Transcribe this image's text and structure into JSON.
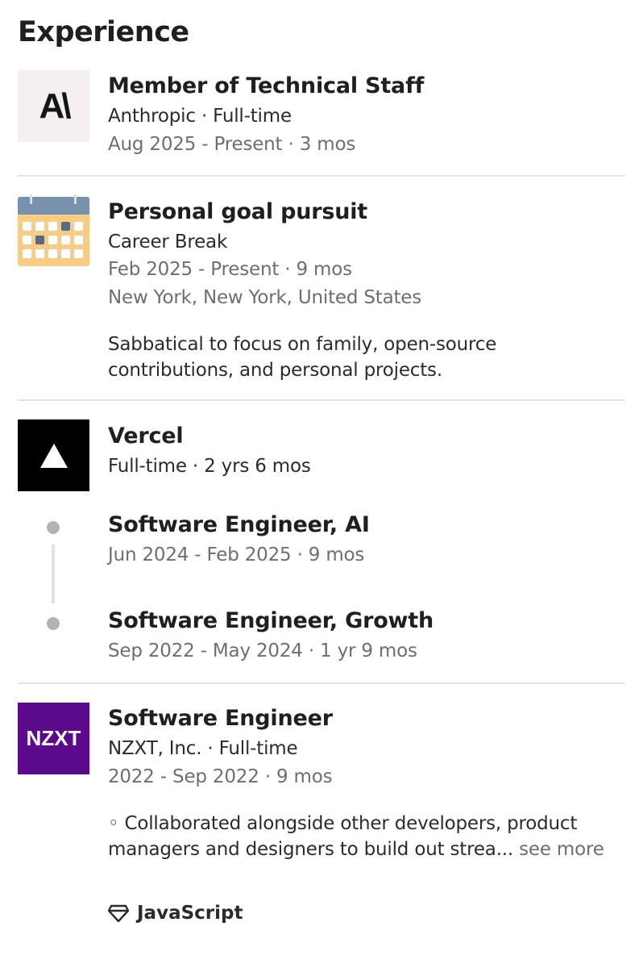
{
  "section": {
    "title": "Experience"
  },
  "entries": {
    "anthropic": {
      "logo_text": "A\\",
      "title": "Member of Technical Staff",
      "company": "Anthropic · Full-time",
      "dates": "Aug 2025 - Present · 3 mos",
      "logo_bg": "#f4eeee"
    },
    "career_break": {
      "title": "Personal goal pursuit",
      "subtitle": "Career Break",
      "dates": "Feb 2025 - Present · 9 mos",
      "location": "New York, New York, United States",
      "desc_line1": "Sabbatical to focus on family, open-source",
      "desc_line2": "contributions, and personal projects."
    },
    "vercel": {
      "company": "Vercel",
      "duration": "Full-time · 2 yrs 6 mos",
      "roles": [
        {
          "title": "Software Engineer, AI",
          "dates": "Jun 2024 - Feb 2025 · 9 mos"
        },
        {
          "title": "Software Engineer, Growth",
          "dates": "Sep 2022 - May 2024 · 1 yr 9 mos"
        }
      ]
    },
    "nzxt": {
      "logo_text": "NZXT",
      "title": "Software Engineer",
      "company": "NZXT, Inc. · Full-time",
      "dates": "2022 - Sep 2022 · 9 mos",
      "desc_line1": "◦ Collaborated alongside other developers, product",
      "desc_line2": "managers and designers to build out strea...",
      "see_more": " see more",
      "skill": "JavaScript",
      "logo_bg": "#5c0a8c"
    }
  }
}
